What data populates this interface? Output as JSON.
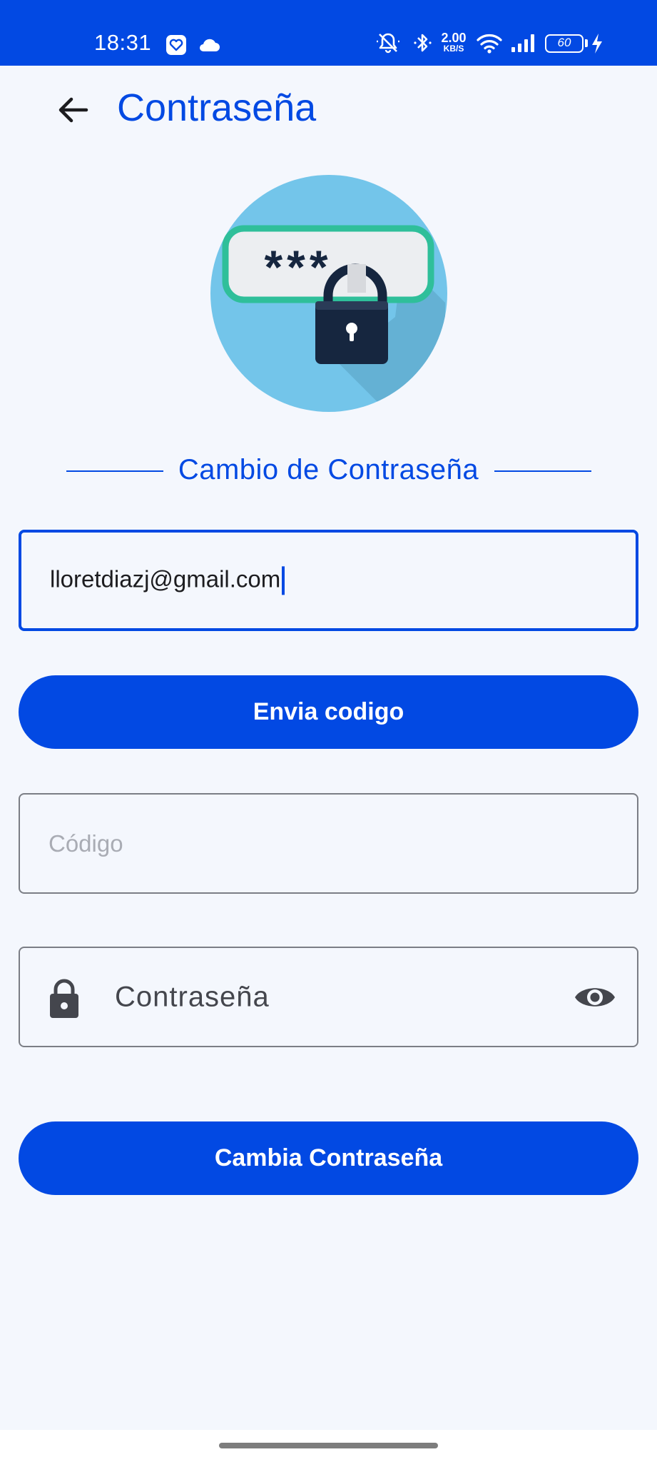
{
  "status_bar": {
    "time": "18:31",
    "net_speed_value": "2.00",
    "net_speed_unit": "KB/S",
    "battery": "60",
    "icons": [
      "health-app-icon",
      "cloud-icon",
      "mute-icon",
      "bluetooth-icon",
      "wifi-icon",
      "signal-icon",
      "battery-icon",
      "charging-icon"
    ]
  },
  "header": {
    "title": "Contraseña",
    "back_icon": "arrow-left-icon"
  },
  "hero": {
    "icon": "password-lock-illustration",
    "mask_text": "***"
  },
  "section": {
    "title": "Cambio de Contraseña"
  },
  "form": {
    "email_value": "lloretdiazj@gmail.com",
    "send_code_label": "Envia codigo",
    "code_placeholder": "Código",
    "password_label": "Contraseña",
    "change_password_label": "Cambia Contraseña"
  },
  "colors": {
    "primary": "#0249e3",
    "background": "#f4f7fd",
    "hero_circle": "#73c5ea",
    "hero_field_border": "#2fbf9a",
    "lock_body": "#16263f"
  }
}
